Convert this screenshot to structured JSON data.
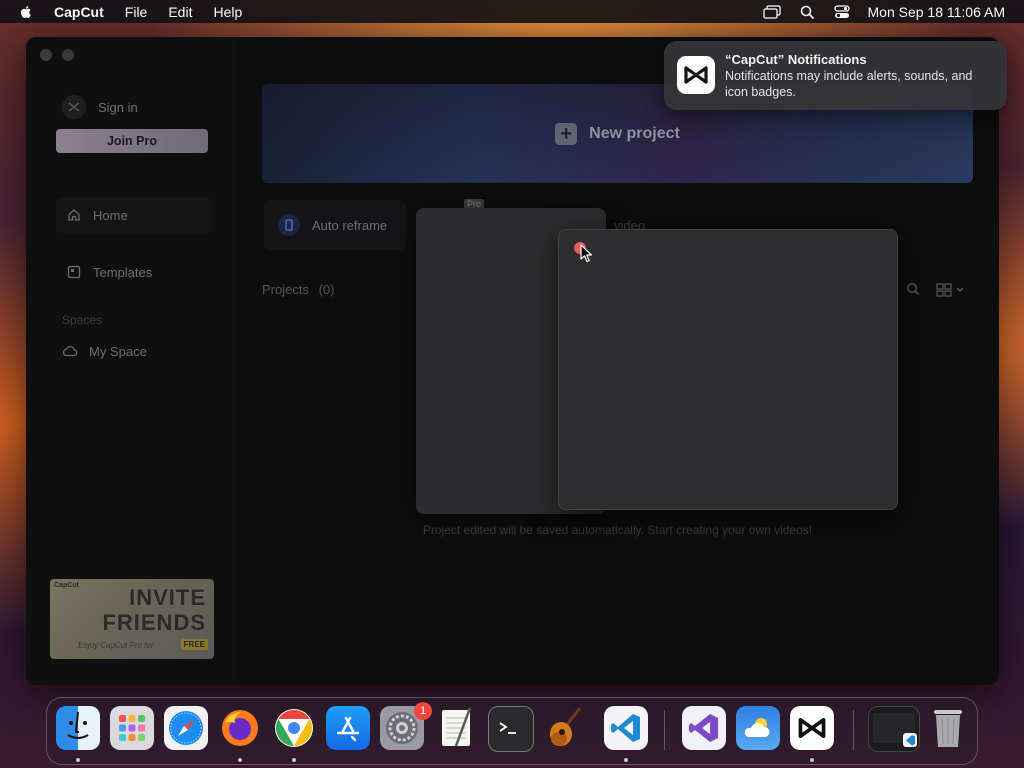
{
  "menubar": {
    "app_name": "CapCut",
    "menus": [
      "File",
      "Edit",
      "Help"
    ],
    "clock": "Mon Sep 18  11:06 AM",
    "status_icons": [
      "screen-mirroring-icon",
      "search-icon",
      "control-center-icon"
    ]
  },
  "window": {
    "sidebar": {
      "sign_in": "Sign in",
      "join_pro": "Join Pro",
      "nav": {
        "home": "Home",
        "templates": "Templates",
        "section": "Spaces",
        "my_space": "My Space"
      },
      "invite": {
        "brand": "CapCut",
        "line1": "INVITE",
        "line2": "FRIENDS",
        "sub": "Enjoy CapCut Pro for",
        "free": "FREE"
      }
    },
    "main": {
      "new_project": "New project",
      "auto_reframe": "Auto reframe",
      "pro_tag": "Pro",
      "video_label": "video",
      "projects_label": "Projects",
      "projects_count": "(0)",
      "empty_hint": "Project edited will be saved automatically. Start creating your own videos!"
    }
  },
  "notification": {
    "title": "“CapCut” Notifications",
    "body": "Notifications may include alerts, sounds, and icon badges."
  },
  "dock": {
    "apps": [
      {
        "name": "Finder",
        "icon": "finder-icon",
        "running": true
      },
      {
        "name": "Launchpad",
        "icon": "launchpad-icon",
        "running": false
      },
      {
        "name": "Safari",
        "icon": "safari-icon",
        "running": false
      },
      {
        "name": "Firefox",
        "icon": "firefox-icon",
        "running": true
      },
      {
        "name": "Chrome",
        "icon": "chrome-icon",
        "running": true
      },
      {
        "name": "App Store",
        "icon": "app-store-icon",
        "running": false
      },
      {
        "name": "System Settings",
        "icon": "settings-icon",
        "running": false,
        "badge": "1"
      },
      {
        "name": "TextEdit",
        "icon": "textedit-icon",
        "running": false
      },
      {
        "name": "Terminal",
        "icon": "terminal-icon",
        "running": false
      },
      {
        "name": "GarageBand",
        "icon": "garageband-icon",
        "running": false
      },
      {
        "name": "VS Code",
        "icon": "vscode-icon",
        "running": true
      },
      {
        "name": "Visual Studio",
        "icon": "visual-studio-icon",
        "running": false
      },
      {
        "name": "Weather",
        "icon": "weather-icon",
        "running": false
      },
      {
        "name": "CapCut",
        "icon": "capcut-icon",
        "running": true
      },
      {
        "name": "Recent window",
        "icon": "recent-window-icon",
        "running": false
      },
      {
        "name": "Trash",
        "icon": "trash-icon",
        "running": false
      }
    ]
  }
}
